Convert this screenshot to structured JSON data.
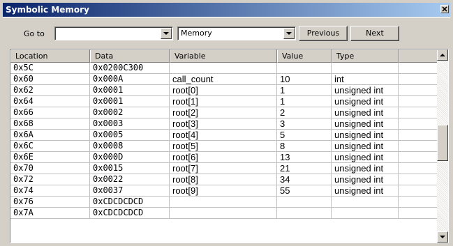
{
  "window": {
    "title": "Symbolic Memory"
  },
  "toolbar": {
    "goto_label": "Go to",
    "goto_value": "",
    "view_value": "Memory",
    "previous_label": "Previous",
    "next_label": "Next"
  },
  "grid": {
    "columns": [
      "Location",
      "Data",
      "Variable",
      "Value",
      "Type",
      ""
    ],
    "rows": [
      {
        "location": "0x5C",
        "data": "0x0200C300",
        "variable": "",
        "value": "",
        "type": ""
      },
      {
        "location": "0x60",
        "data": "0x000A",
        "variable": "call_count",
        "value": "10",
        "type": "int"
      },
      {
        "location": "0x62",
        "data": "0x0001",
        "variable": "root[0]",
        "value": "1",
        "type": "unsigned int"
      },
      {
        "location": "0x64",
        "data": "0x0001",
        "variable": "root[1]",
        "value": "1",
        "type": "unsigned int"
      },
      {
        "location": "0x66",
        "data": "0x0002",
        "variable": "root[2]",
        "value": "2",
        "type": "unsigned int"
      },
      {
        "location": "0x68",
        "data": "0x0003",
        "variable": "root[3]",
        "value": "3",
        "type": "unsigned int"
      },
      {
        "location": "0x6A",
        "data": "0x0005",
        "variable": "root[4]",
        "value": "5",
        "type": "unsigned int"
      },
      {
        "location": "0x6C",
        "data": "0x0008",
        "variable": "root[5]",
        "value": "8",
        "type": "unsigned int"
      },
      {
        "location": "0x6E",
        "data": "0x000D",
        "variable": "root[6]",
        "value": "13",
        "type": "unsigned int"
      },
      {
        "location": "0x70",
        "data": "0x0015",
        "variable": "root[7]",
        "value": "21",
        "type": "unsigned int"
      },
      {
        "location": "0x72",
        "data": "0x0022",
        "variable": "root[8]",
        "value": "34",
        "type": "unsigned int"
      },
      {
        "location": "0x74",
        "data": "0x0037",
        "variable": "root[9]",
        "value": "55",
        "type": "unsigned int"
      },
      {
        "location": "0x76",
        "data": "0xCDCDCDCD",
        "variable": "",
        "value": "",
        "type": ""
      },
      {
        "location": "0x7A",
        "data": "0xCDCDCDCD",
        "variable": "",
        "value": "",
        "type": ""
      }
    ]
  },
  "icons": {
    "close": "close-icon",
    "dropdown": "chevron-down-icon",
    "scroll_up": "scroll-up-arrow-icon",
    "scroll_down": "scroll-down-arrow-icon"
  },
  "colors": {
    "titlebar_start": "#0a246a",
    "titlebar_end": "#a6caf0",
    "face": "#d4d0c8"
  }
}
